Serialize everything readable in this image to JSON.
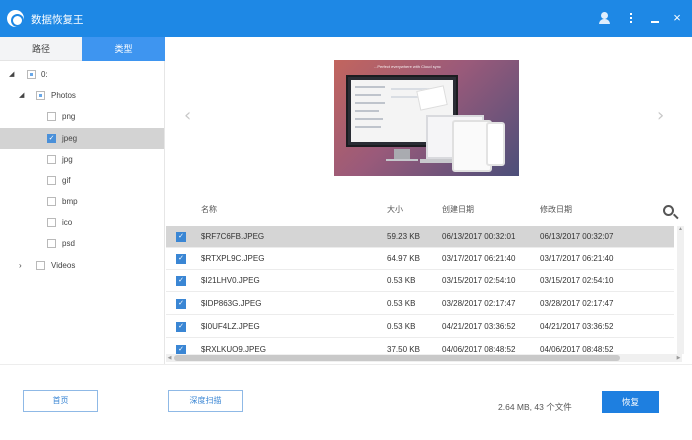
{
  "window": {
    "title": "数据恢复王",
    "brand_color": "#1e88e5",
    "icons": [
      "app-logo-icon",
      "user-icon",
      "more-icon",
      "minimize-icon",
      "close-icon"
    ],
    "close_glyph": "×"
  },
  "sidebar": {
    "tabs": [
      {
        "label": "路径",
        "active": false
      },
      {
        "label": "类型",
        "active": true
      }
    ],
    "tree": [
      {
        "label": "0:",
        "checked": "partial",
        "expanded": true
      },
      {
        "label": "Photos",
        "checked": "partial",
        "expanded": true
      },
      {
        "label": "png",
        "checked": false
      },
      {
        "label": "jpeg",
        "checked": true,
        "selected": true
      },
      {
        "label": "jpg",
        "checked": false
      },
      {
        "label": "gif",
        "checked": false
      },
      {
        "label": "bmp",
        "checked": false
      },
      {
        "label": "ico",
        "checked": false
      },
      {
        "label": "psd",
        "checked": false
      },
      {
        "label": "Videos",
        "checked": false,
        "expanded": false
      }
    ]
  },
  "preview": {
    "caption": "...Perfect everywhere with Cloud sync",
    "prev_glyph": "‹",
    "next_glyph": "›"
  },
  "table": {
    "headers": {
      "name": "名称",
      "size": "大小",
      "created": "创建日期",
      "modified": "修改日期"
    },
    "rows": [
      {
        "name": "$RF7C6FB.JPEG",
        "size": "59.23 KB",
        "created": "06/13/2017 00:32:01",
        "modified": "06/13/2017 00:32:07",
        "checked": true,
        "selected": true
      },
      {
        "name": "$RTXPL9C.JPEG",
        "size": "64.97 KB",
        "created": "03/17/2017 06:21:40",
        "modified": "03/17/2017 06:21:40",
        "checked": true
      },
      {
        "name": "$I21LHV0.JPEG",
        "size": "0.53 KB",
        "created": "03/15/2017 02:54:10",
        "modified": "03/15/2017 02:54:10",
        "checked": true
      },
      {
        "name": "$IDP863G.JPEG",
        "size": "0.53 KB",
        "created": "03/28/2017 02:17:47",
        "modified": "03/28/2017 02:17:47",
        "checked": true
      },
      {
        "name": "$I0UF4LZ.JPEG",
        "size": "0.53 KB",
        "created": "04/21/2017 03:36:52",
        "modified": "04/21/2017 03:36:52",
        "checked": true
      },
      {
        "name": "$RXLKUO9.JPEG",
        "size": "37.50 KB",
        "created": "04/06/2017 08:48:52",
        "modified": "04/06/2017 08:48:52",
        "checked": true
      }
    ]
  },
  "footer": {
    "home_label": "首页",
    "deep_scan_label": "深度扫描",
    "summary": "2.64 MB, 43 个文件",
    "recover_label": "恢复"
  }
}
